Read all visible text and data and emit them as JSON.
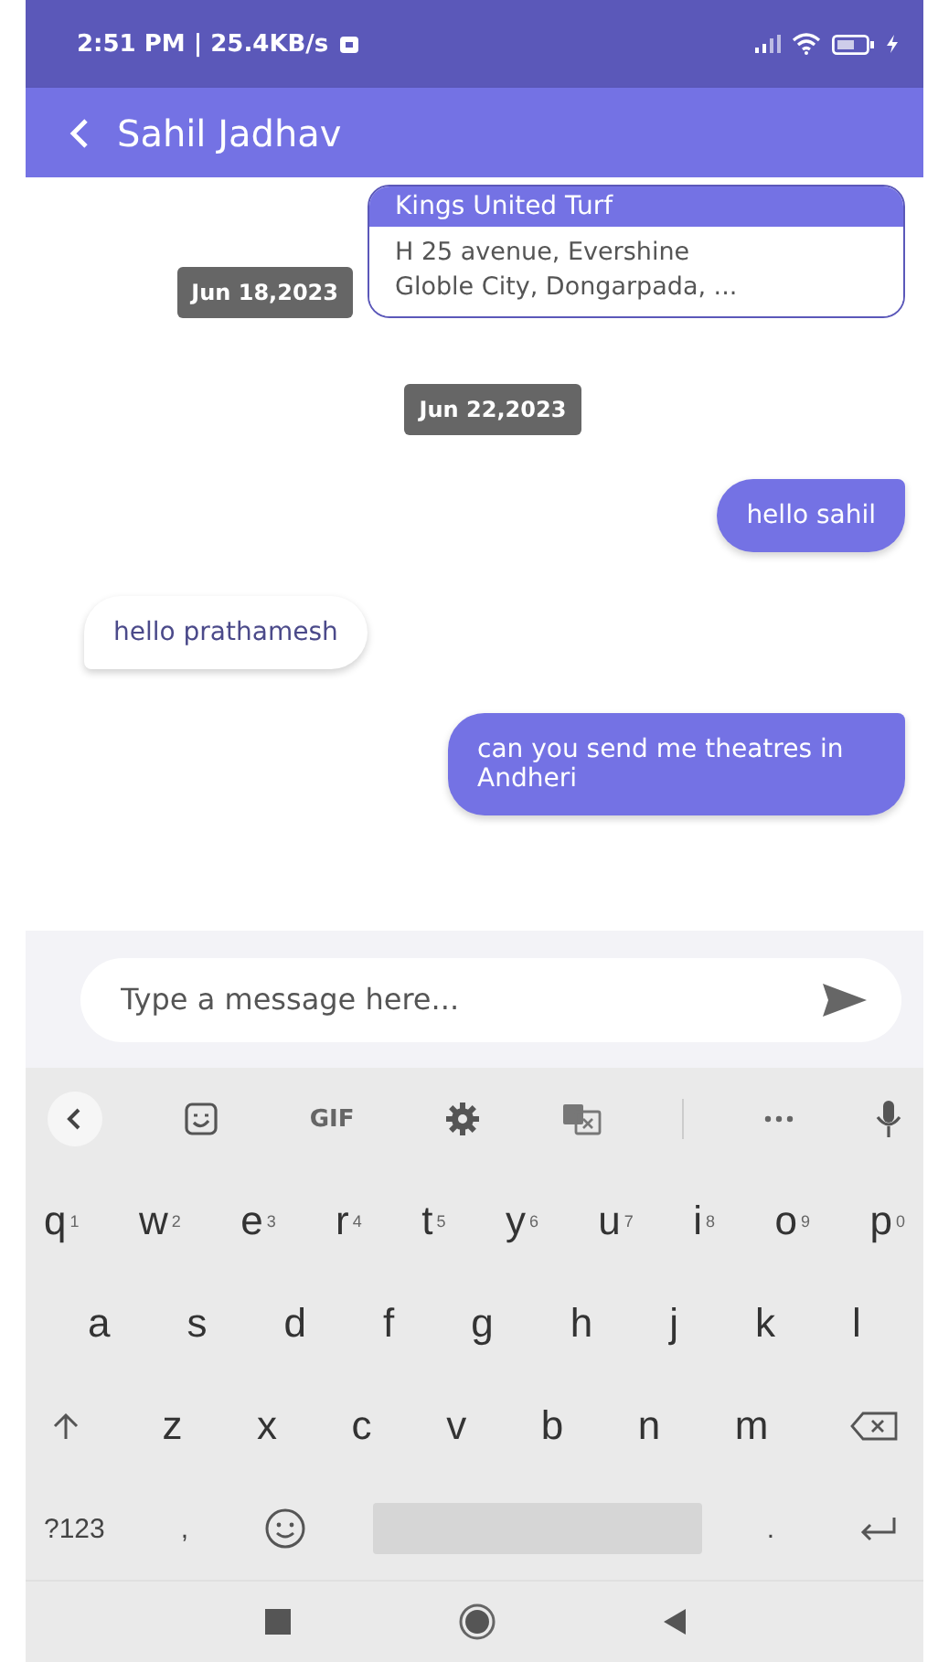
{
  "status_bar": {
    "time": "2:51 PM | 25.4KB/s"
  },
  "app_bar": {
    "title": "Sahil Jadhav"
  },
  "messages": [
    {
      "kind": "card",
      "title": "Kings United Turf",
      "address_lines": [
        "H 25 avenue, Evershine",
        "Globle City, Dongarpada, ..."
      ],
      "date": "Jun 18,2023"
    },
    {
      "kind": "date",
      "text": "Jun 22,2023"
    },
    {
      "kind": "text",
      "outgoing": true,
      "text": "hello sahil"
    },
    {
      "kind": "text",
      "outgoing": false,
      "text": "hello prathamesh"
    },
    {
      "kind": "text",
      "outgoing": true,
      "text": "can you send me theatres in Andheri"
    }
  ],
  "composer": {
    "placeholder": "Type a message here..."
  },
  "keyboard": {
    "toolbar": [
      {
        "kind": "back"
      },
      {
        "kind": "sticker"
      },
      {
        "kind": "text",
        "label": "GIF"
      },
      {
        "kind": "settings"
      },
      {
        "kind": "translate"
      },
      {
        "kind": "divider"
      },
      {
        "kind": "more"
      },
      {
        "kind": "mic"
      }
    ],
    "rows": [
      [
        {
          "kind": "letter",
          "label": "q",
          "hint": "1"
        },
        {
          "kind": "letter",
          "label": "w",
          "hint": "2"
        },
        {
          "kind": "letter",
          "label": "e",
          "hint": "3"
        },
        {
          "kind": "letter",
          "label": "r",
          "hint": "4"
        },
        {
          "kind": "letter",
          "label": "t",
          "hint": "5"
        },
        {
          "kind": "letter",
          "label": "y",
          "hint": "6"
        },
        {
          "kind": "letter",
          "label": "u",
          "hint": "7"
        },
        {
          "kind": "letter",
          "label": "i",
          "hint": "8"
        },
        {
          "kind": "letter",
          "label": "o",
          "hint": "9"
        },
        {
          "kind": "letter",
          "label": "p",
          "hint": "0"
        }
      ],
      [
        {
          "kind": "letter",
          "label": "a"
        },
        {
          "kind": "letter",
          "label": "s"
        },
        {
          "kind": "letter",
          "label": "d"
        },
        {
          "kind": "letter",
          "label": "f"
        },
        {
          "kind": "letter",
          "label": "g"
        },
        {
          "kind": "letter",
          "label": "h"
        },
        {
          "kind": "letter",
          "label": "j"
        },
        {
          "kind": "letter",
          "label": "k"
        },
        {
          "kind": "letter",
          "label": "l"
        }
      ],
      [
        {
          "kind": "shift"
        },
        {
          "kind": "letter",
          "label": "z"
        },
        {
          "kind": "letter",
          "label": "x"
        },
        {
          "kind": "letter",
          "label": "c"
        },
        {
          "kind": "letter",
          "label": "v"
        },
        {
          "kind": "letter",
          "label": "b"
        },
        {
          "kind": "letter",
          "label": "n"
        },
        {
          "kind": "letter",
          "label": "m"
        },
        {
          "kind": "backspace"
        }
      ],
      [
        {
          "kind": "text",
          "label": "?123"
        },
        {
          "kind": "text",
          "label": ","
        },
        {
          "kind": "emoji"
        },
        {
          "kind": "space"
        },
        {
          "kind": "text",
          "label": "."
        },
        {
          "kind": "enter"
        }
      ]
    ]
  }
}
